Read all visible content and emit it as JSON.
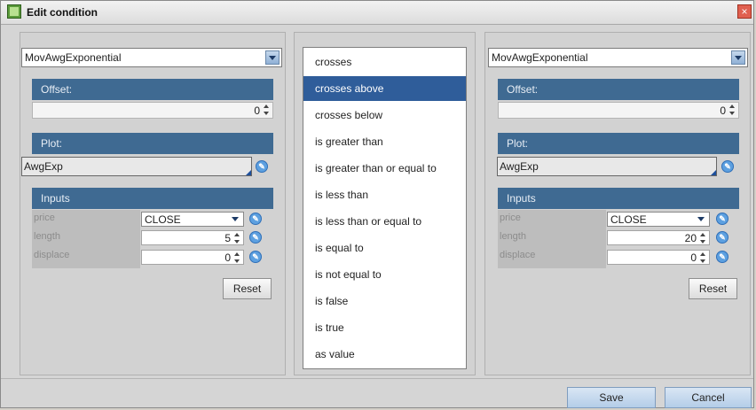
{
  "window": {
    "title": "Edit condition",
    "close_label": "×"
  },
  "left": {
    "study": "MovAwgExponential",
    "offset_label": "Offset:",
    "offset_value": "0",
    "plot_label": "Plot:",
    "plot_value": "AwgExp",
    "inputs_label": "Inputs",
    "inputs": [
      {
        "name": "price",
        "value": "CLOSE"
      },
      {
        "name": "length",
        "value": "5"
      },
      {
        "name": "displace",
        "value": "0"
      }
    ],
    "reset_label": "Reset"
  },
  "operators": {
    "selected_index": 1,
    "items": [
      "crosses",
      "crosses above",
      "crosses below",
      "is greater than",
      "is greater than or equal to",
      "is less than",
      "is less than or equal to",
      "is equal to",
      "is not equal to",
      "is false",
      "is true",
      "as value"
    ]
  },
  "right": {
    "study": "MovAwgExponential",
    "offset_label": "Offset:",
    "offset_value": "0",
    "plot_label": "Plot:",
    "plot_value": "AwgExp",
    "inputs_label": "Inputs",
    "inputs": [
      {
        "name": "price",
        "value": "CLOSE"
      },
      {
        "name": "length",
        "value": "20"
      },
      {
        "name": "displace",
        "value": "0"
      }
    ],
    "reset_label": "Reset"
  },
  "footer": {
    "save_label": "Save",
    "cancel_label": "Cancel"
  }
}
